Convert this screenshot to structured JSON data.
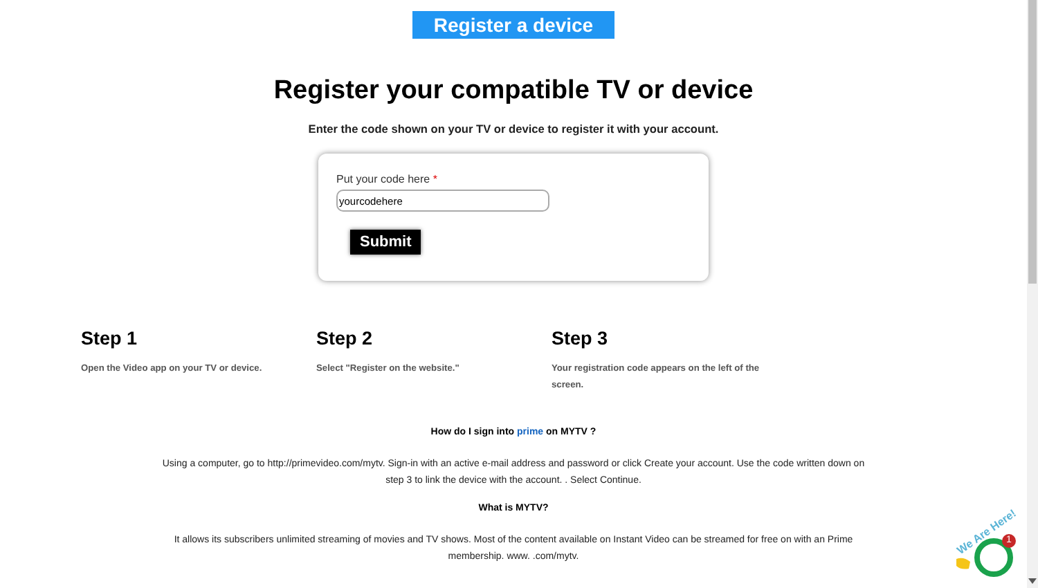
{
  "banner": {
    "label": "Register a device"
  },
  "title": "Register your compatible TV or device",
  "subtitle": "Enter the code shown on your TV or device to register it with your account.",
  "form": {
    "label": "Put your code here",
    "required_mark": "*",
    "value": "yourcodehere",
    "submit": "Submit"
  },
  "steps": [
    {
      "title": "Step 1",
      "text": "Open the  Video app on your TV or device."
    },
    {
      "title": "Step 2",
      "text": "Select \"Register on the  website.\""
    },
    {
      "title": "Step 3",
      "text": "Your registration code appears on the left of the screen."
    }
  ],
  "faq": [
    {
      "question": [
        {
          "text": "How do I sign into ",
          "link": false
        },
        {
          "text": "prime",
          "link": true
        },
        {
          "text": " on MYTV ?",
          "link": false
        }
      ],
      "answer": "Using a computer, go to http://primevideo.com/mytv. Sign-in with an active e-mail address and password or click Create your account. Use the code written down on step 3 to link the device with the account. . Select Continue."
    },
    {
      "question": [
        {
          "text": "What is MYTV?",
          "link": false
        }
      ],
      "answer": "It allows its subscribers unlimited streaming of movies and TV shows. Most of the content available on Instant Video can be streamed for free on with an Prime membership. www. .com/mytv."
    }
  ],
  "chat": {
    "caption": "We Are Here!",
    "badge": "1"
  }
}
